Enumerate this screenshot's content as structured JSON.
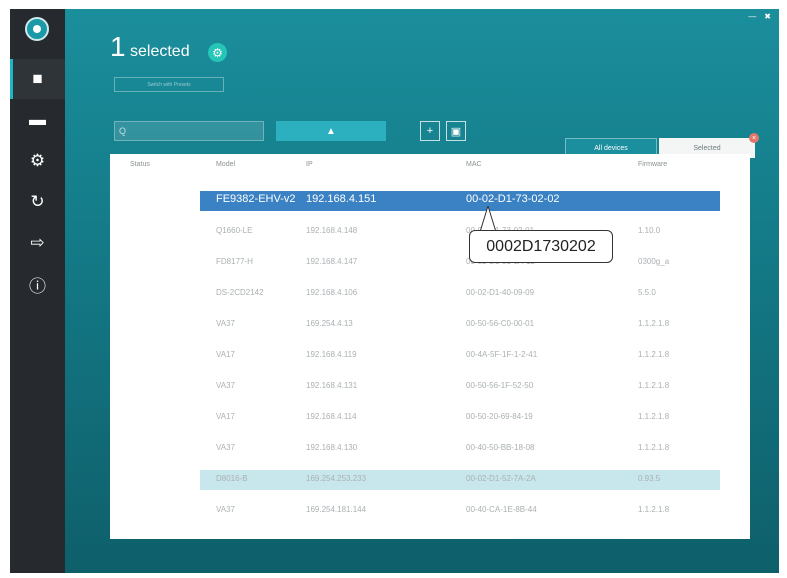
{
  "header": {
    "count": "1",
    "label": "selected",
    "switch_button": "Switch with Presets"
  },
  "icons": {
    "logo": "logo-icon",
    "home": "home-icon",
    "devices": "devices-icon",
    "settings": "settings-icon",
    "sync": "sync-icon",
    "export": "export-icon",
    "info": "info-icon",
    "search": "search-icon",
    "upload": "upload-icon",
    "add": "add-icon",
    "folder": "folder-icon",
    "close": "close-icon"
  },
  "colors": {
    "accent": "#2cb0c0",
    "selected_row": "#3b82c4",
    "hover_row": "#c8e7ec",
    "sidebar": "#262a2e"
  },
  "toolbar": {
    "search_placeholder": "Q",
    "tab_all": "All devices",
    "tab_selected": "Selected"
  },
  "table": {
    "headers": [
      "Status",
      "Model",
      "IP",
      "MAC",
      "Firmware"
    ],
    "rows": [
      [
        "",
        "FE9382-EHV-v2",
        "192.168.4.151",
        "00-02-D1-73-02-02",
        ""
      ],
      [
        "",
        "Q1660-LE",
        "192.168.4.148",
        "00-02-D1-73-02-01",
        "1.10.0"
      ],
      [
        "",
        "FD8177-H",
        "192.168.4.147",
        "00-02-D1-51-3A-12",
        "0300g_a"
      ],
      [
        "",
        "DS-2CD2142",
        "192.168.4.106",
        "00-02-D1-40-09-09",
        "5.5.0"
      ],
      [
        "",
        "VA37",
        "169.254.4.13",
        "00-50-56-C0-00-01",
        "1.1.2.1.8"
      ],
      [
        "",
        "VA17",
        "192.168.4.119",
        "00-4A-5F-1F-1-2-41",
        "1.1.2.1.8"
      ],
      [
        "",
        "VA37",
        "192.168.4.131",
        "00-50-56-1F-52-50",
        "1.1.2.1.8"
      ],
      [
        "",
        "VA17",
        "192.168.4.114",
        "00-50-20-69-84-19",
        "1.1.2.1.8"
      ],
      [
        "",
        "VA37",
        "192.168.4.130",
        "00-40-50-BB-18-08",
        "1.1.2.1.8"
      ],
      [
        "",
        "D8016-B",
        "169.254.253.233",
        "00-02-D1-52-7A-2A",
        "0.93.5"
      ],
      [
        "",
        "VA37",
        "169.254.181.144",
        "00-40-CA-1E-8B-44",
        "1.1.2.1.8"
      ]
    ]
  },
  "callout": {
    "text": "0002D1730202"
  }
}
